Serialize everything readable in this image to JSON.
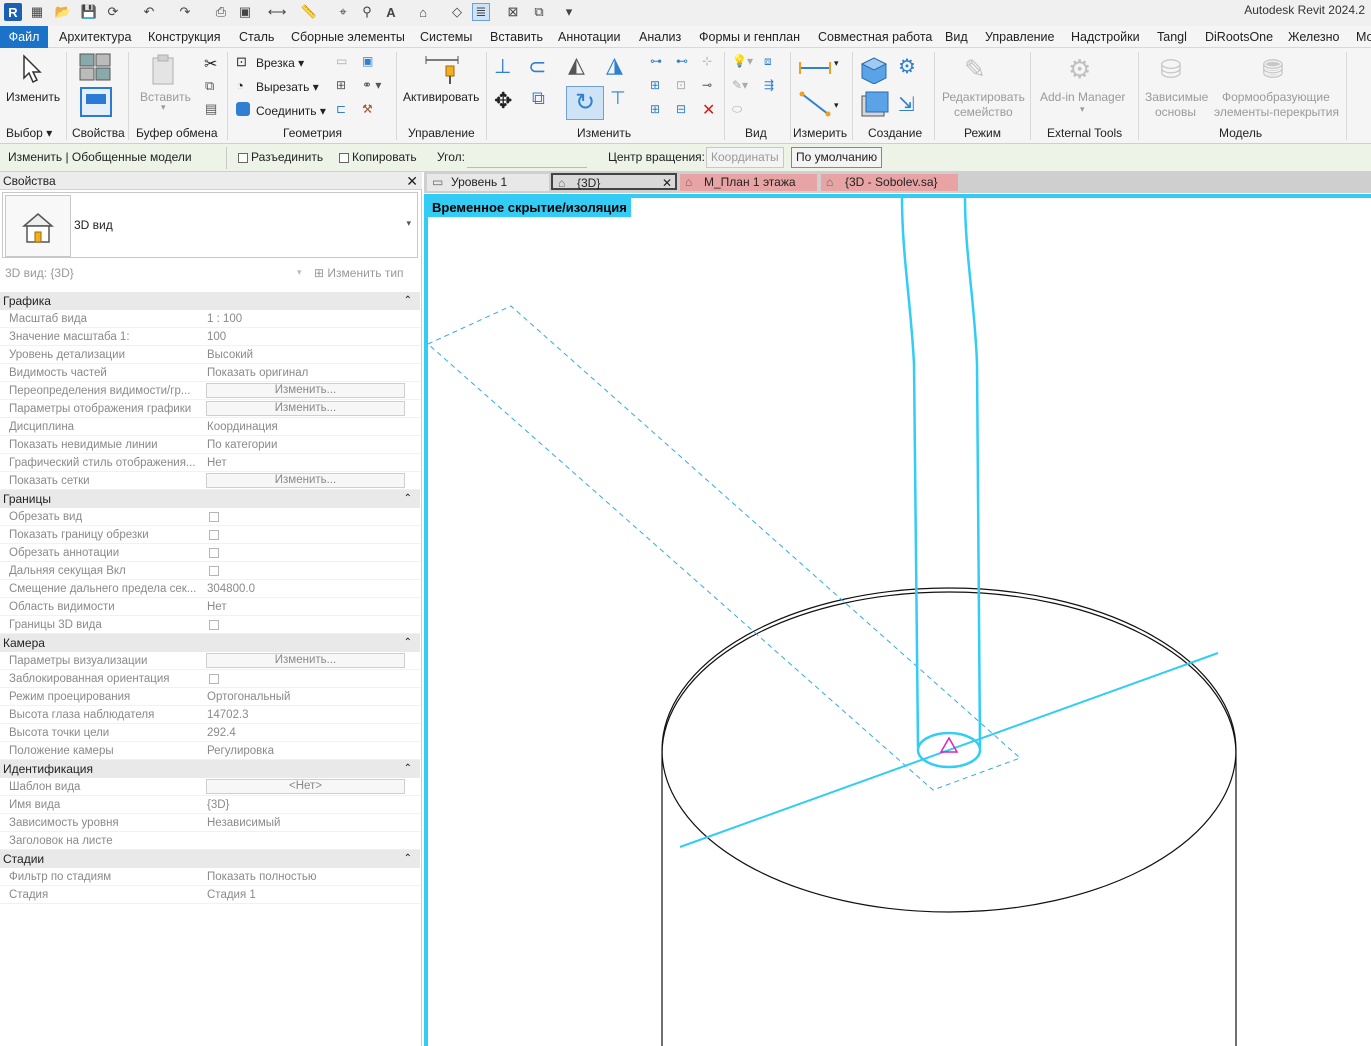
{
  "app": {
    "title": "Autodesk Revit 2024.2"
  },
  "menu": {
    "file": "Файл",
    "tabs": [
      "Архитектура",
      "Конструкция",
      "Сталь",
      "Сборные элементы",
      "Системы",
      "Вставить",
      "Аннотации",
      "Анализ",
      "Формы и генплан",
      "Совместная работа",
      "Вид",
      "Управление",
      "Надстройки",
      "Tangl",
      "DiRootsOne",
      "Железно",
      "Мо"
    ]
  },
  "ribbon": {
    "modify_label": "Изменить",
    "properties_label": "Свойства",
    "paste_label": "Вставить",
    "cope_label": "Врезка",
    "cut_label": "Вырезать",
    "join_label": "Соединить",
    "activate_label": "Активировать",
    "edit_family_label": "Редактировать семейство",
    "edit_family_line1": "Редактировать",
    "edit_family_line2": "семейство",
    "addin_manager_label": "Add-in Manager",
    "dependent_label_line1": "Зависимые",
    "dependent_label_line2": "основы",
    "formwork_label_line1": "Формообразующие",
    "formwork_label_line2": "элементы-перекрытия",
    "panels": {
      "select": "Выбор",
      "properties": "Свойства",
      "clipboard": "Буфер обмена",
      "geometry": "Геометрия",
      "control": "Управление",
      "modify": "Изменить",
      "view": "Вид",
      "measure": "Измерить",
      "create": "Создание",
      "mode": "Режим",
      "external_tools": "External Tools",
      "model": "Модель"
    }
  },
  "options_bar": {
    "context": "Изменить | Обобщенные модели",
    "disjoin": "Разъединить",
    "copy": "Копировать",
    "angle_label": "Угол:",
    "angle_value": "",
    "rotation_center_label": "Центр вращения:",
    "coordinates_btn": "Координаты",
    "default_btn": "По умолчанию"
  },
  "properties": {
    "title": "Свойства",
    "type_name": "3D вид",
    "instance_selector": "3D вид: {3D}",
    "edit_type": "Изменить тип",
    "sections": [
      {
        "name": "Графика",
        "rows": [
          {
            "k": "Масштаб вида",
            "v": "1 : 100",
            "t": "text"
          },
          {
            "k": "Значение масштаба    1:",
            "v": "100",
            "t": "text"
          },
          {
            "k": "Уровень детализации",
            "v": "Высокий",
            "t": "text"
          },
          {
            "k": "Видимость частей",
            "v": "Показать оригинал",
            "t": "text"
          },
          {
            "k": "Переопределения видимости/гр...",
            "v": "Изменить...",
            "t": "btn"
          },
          {
            "k": "Параметры отображения графики",
            "v": "Изменить...",
            "t": "btn"
          },
          {
            "k": "Дисциплина",
            "v": "Координация",
            "t": "text"
          },
          {
            "k": "Показать невидимые линии",
            "v": "По категории",
            "t": "text"
          },
          {
            "k": "Графический стиль отображения...",
            "v": "Нет",
            "t": "text"
          },
          {
            "k": "Показать сетки",
            "v": "Изменить...",
            "t": "btn"
          }
        ]
      },
      {
        "name": "Границы",
        "rows": [
          {
            "k": "Обрезать вид",
            "v": "",
            "t": "cb"
          },
          {
            "k": "Показать границу обрезки",
            "v": "",
            "t": "cb"
          },
          {
            "k": "Обрезать аннотации",
            "v": "",
            "t": "cb"
          },
          {
            "k": "Дальняя секущая Вкл",
            "v": "",
            "t": "cb"
          },
          {
            "k": "Смещение дальнего предела сек...",
            "v": "304800.0",
            "t": "text"
          },
          {
            "k": "Область видимости",
            "v": "Нет",
            "t": "text"
          },
          {
            "k": "Границы 3D вида",
            "v": "",
            "t": "cb"
          }
        ]
      },
      {
        "name": "Камера",
        "rows": [
          {
            "k": "Параметры визуализации",
            "v": "Изменить...",
            "t": "btn"
          },
          {
            "k": "Заблокированная ориентация",
            "v": "",
            "t": "cb"
          },
          {
            "k": "Режим проецирования",
            "v": "Ортогональный",
            "t": "text"
          },
          {
            "k": "Высота глаза наблюдателя",
            "v": "14702.3",
            "t": "text"
          },
          {
            "k": "Высота точки цели",
            "v": "292.4",
            "t": "text"
          },
          {
            "k": "Положение камеры",
            "v": "Регулировка",
            "t": "text"
          }
        ]
      },
      {
        "name": "Идентификация",
        "rows": [
          {
            "k": "Шаблон вида",
            "v": "<Нет>",
            "t": "btn"
          },
          {
            "k": "Имя вида",
            "v": "{3D}",
            "t": "text"
          },
          {
            "k": "Зависимость уровня",
            "v": "Независимый",
            "t": "text"
          },
          {
            "k": "Заголовок на листе",
            "v": "",
            "t": "text"
          }
        ]
      },
      {
        "name": "Стадии",
        "rows": [
          {
            "k": "Фильтр по стадиям",
            "v": "Показать полностью",
            "t": "text"
          },
          {
            "k": "Стадия",
            "v": "Стадия 1",
            "t": "text"
          }
        ]
      }
    ]
  },
  "view_tabs": [
    {
      "label": "Уровень 1",
      "active": false,
      "color": "#e8e8e8"
    },
    {
      "label": "{3D}",
      "active": true,
      "color": "#d9d9d9"
    },
    {
      "label": "M_План 1 этажа",
      "active": false,
      "color": "#e8a4a4"
    },
    {
      "label": "{3D - Sobolev.sa}",
      "active": false,
      "color": "#e8a4a4"
    }
  ],
  "canvas": {
    "mode_label": "Временное скрытие/изоляция",
    "accent": "#33ccf5",
    "cursor_marker": "#e020c0"
  }
}
